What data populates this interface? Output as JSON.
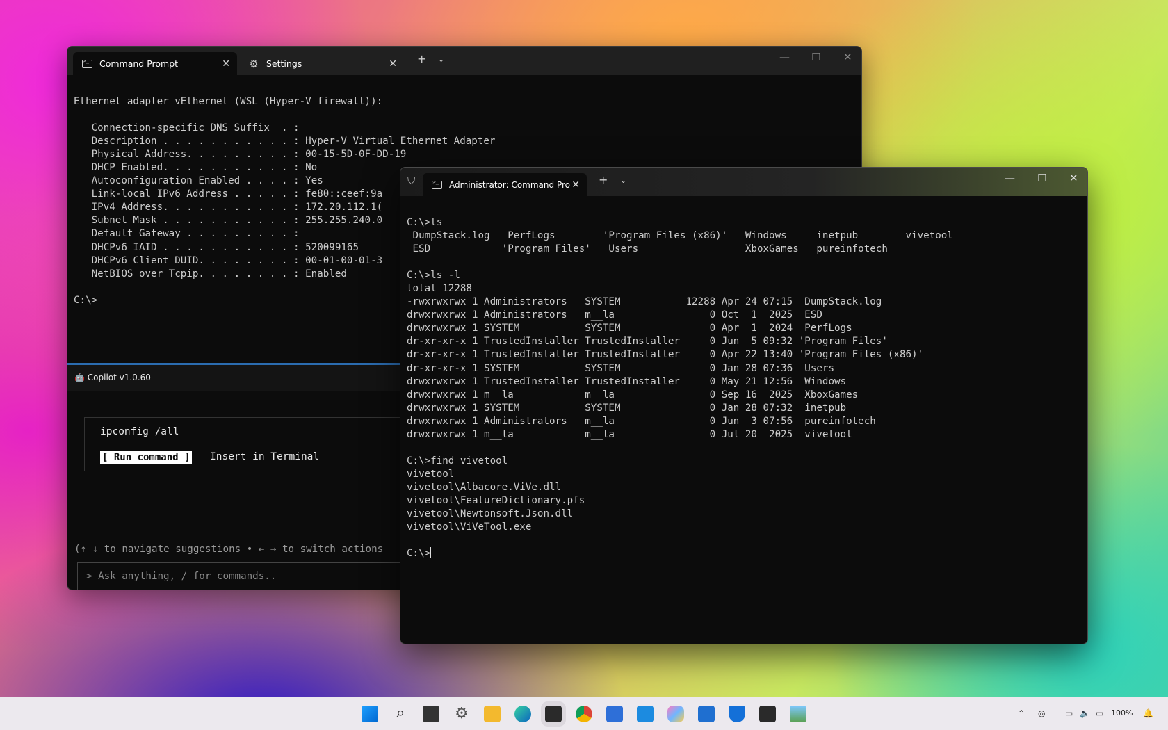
{
  "window1": {
    "tabs": [
      {
        "label": "Command Prompt",
        "icon": "cmd-icon"
      },
      {
        "label": "Settings",
        "icon": "gear-icon"
      }
    ],
    "terminal_lines": [
      "Ethernet adapter vEthernet (WSL (Hyper-V firewall)):",
      "",
      "   Connection-specific DNS Suffix  . :",
      "   Description . . . . . . . . . . . : Hyper-V Virtual Ethernet Adapter",
      "   Physical Address. . . . . . . . . : 00-15-5D-0F-DD-19",
      "   DHCP Enabled. . . . . . . . . . . : No",
      "   Autoconfiguration Enabled . . . . : Yes",
      "   Link-local IPv6 Address . . . . . : fe80::ceef:9a",
      "   IPv4 Address. . . . . . . . . . . : 172.20.112.1(",
      "   Subnet Mask . . . . . . . . . . . : 255.255.240.0",
      "   Default Gateway . . . . . . . . . :",
      "   DHCPv6 IAID . . . . . . . . . . . : 520099165",
      "   DHCPv6 Client DUID. . . . . . . . : 00-01-00-01-3",
      "   NetBIOS over Tcpip. . . . . . . . : Enabled",
      "",
      "C:\\>"
    ],
    "copilot": {
      "title": "Copilot v1.0.60",
      "suggested_command": "ipconfig /all",
      "run_label": "[ Run command ]",
      "insert_label": "Insert in Terminal",
      "nav_hint": "(↑ ↓ to navigate suggestions • ← → to switch actions",
      "ask_placeholder": "> Ask anything, / for commands.."
    }
  },
  "window2": {
    "tab_label": "Administrator: Command Pro",
    "terminal_lines": [
      "C:\\>ls",
      " DumpStack.log   PerfLogs        'Program Files (x86)'   Windows     inetpub        vivetool",
      " ESD            'Program Files'   Users                  XboxGames   pureinfotech",
      "",
      "C:\\>ls -l",
      "total 12288",
      "-rwxrwxrwx 1 Administrators   SYSTEM           12288 Apr 24 07:15  DumpStack.log",
      "drwxrwxrwx 1 Administrators   m__la                0 Oct  1  2025  ESD",
      "drwxrwxrwx 1 SYSTEM           SYSTEM               0 Apr  1  2024  PerfLogs",
      "dr-xr-xr-x 1 TrustedInstaller TrustedInstaller     0 Jun  5 09:32 'Program Files'",
      "dr-xr-xr-x 1 TrustedInstaller TrustedInstaller     0 Apr 22 13:40 'Program Files (x86)'",
      "dr-xr-xr-x 1 SYSTEM           SYSTEM               0 Jan 28 07:36  Users",
      "drwxrwxrwx 1 TrustedInstaller TrustedInstaller     0 May 21 12:56  Windows",
      "drwxrwxrwx 1 m__la            m__la                0 Sep 16  2025  XboxGames",
      "drwxrwxrwx 1 SYSTEM           SYSTEM               0 Jan 28 07:32  inetpub",
      "drwxrwxrwx 1 Administrators   m__la                0 Jun  3 07:56  pureinfotech",
      "drwxrwxrwx 1 m__la            m__la                0 Jul 20  2025  vivetool",
      "",
      "C:\\>find vivetool",
      "vivetool",
      "vivetool\\Albacore.ViVe.dll",
      "vivetool\\FeatureDictionary.pfs",
      "vivetool\\Newtonsoft.Json.dll",
      "vivetool\\ViVeTool.exe",
      ""
    ],
    "prompt": "C:\\>"
  },
  "taskbar": {
    "icons": [
      "windows-start-icon",
      "search-icon",
      "task-view-icon",
      "settings-icon",
      "file-explorer-icon",
      "edge-icon",
      "terminal-icon",
      "chrome-icon",
      "notepad-icon",
      "vscode-icon",
      "copilot-icon",
      "store-icon",
      "defender-icon",
      "admin-terminal-icon",
      "photos-icon"
    ],
    "battery": "100%"
  },
  "colors": {
    "terminal_bg": "#0c0c0c",
    "terminal_text": "#cccccc",
    "accent": "#2b6cb0"
  }
}
